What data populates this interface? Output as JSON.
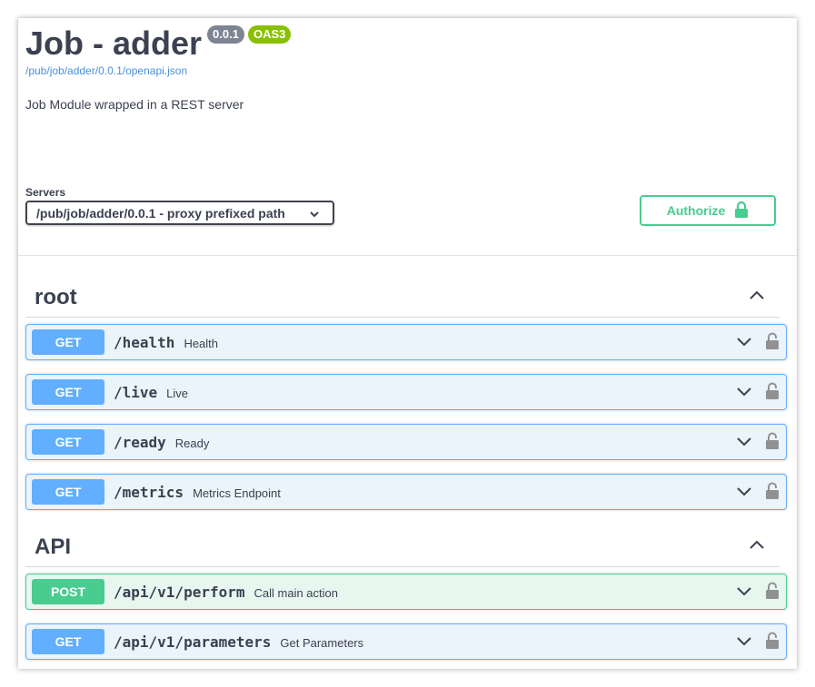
{
  "info": {
    "title": "Job - adder",
    "version": "0.0.1",
    "oas_badge": "OAS3",
    "spec_url": "/pub/job/adder/0.0.1/openapi.json",
    "description": "Job Module wrapped in a REST server"
  },
  "servers": {
    "label": "Servers",
    "selected": "/pub/job/adder/0.0.1 - proxy prefixed path"
  },
  "authorize": {
    "label": "Authorize"
  },
  "colors": {
    "get": "#61affe",
    "post": "#49cc90",
    "badge_version": "#7d8492",
    "badge_oas": "#89bf04"
  },
  "tags": [
    {
      "name": "root",
      "operations": [
        {
          "method": "GET",
          "path": "/health",
          "summary": "Health"
        },
        {
          "method": "GET",
          "path": "/live",
          "summary": "Live"
        },
        {
          "method": "GET",
          "path": "/ready",
          "summary": "Ready"
        },
        {
          "method": "GET",
          "path": "/metrics",
          "summary": "Metrics Endpoint"
        }
      ]
    },
    {
      "name": "API",
      "operations": [
        {
          "method": "POST",
          "path": "/api/v1/perform",
          "summary": "Call main action"
        },
        {
          "method": "GET",
          "path": "/api/v1/parameters",
          "summary": "Get Parameters"
        }
      ]
    }
  ]
}
